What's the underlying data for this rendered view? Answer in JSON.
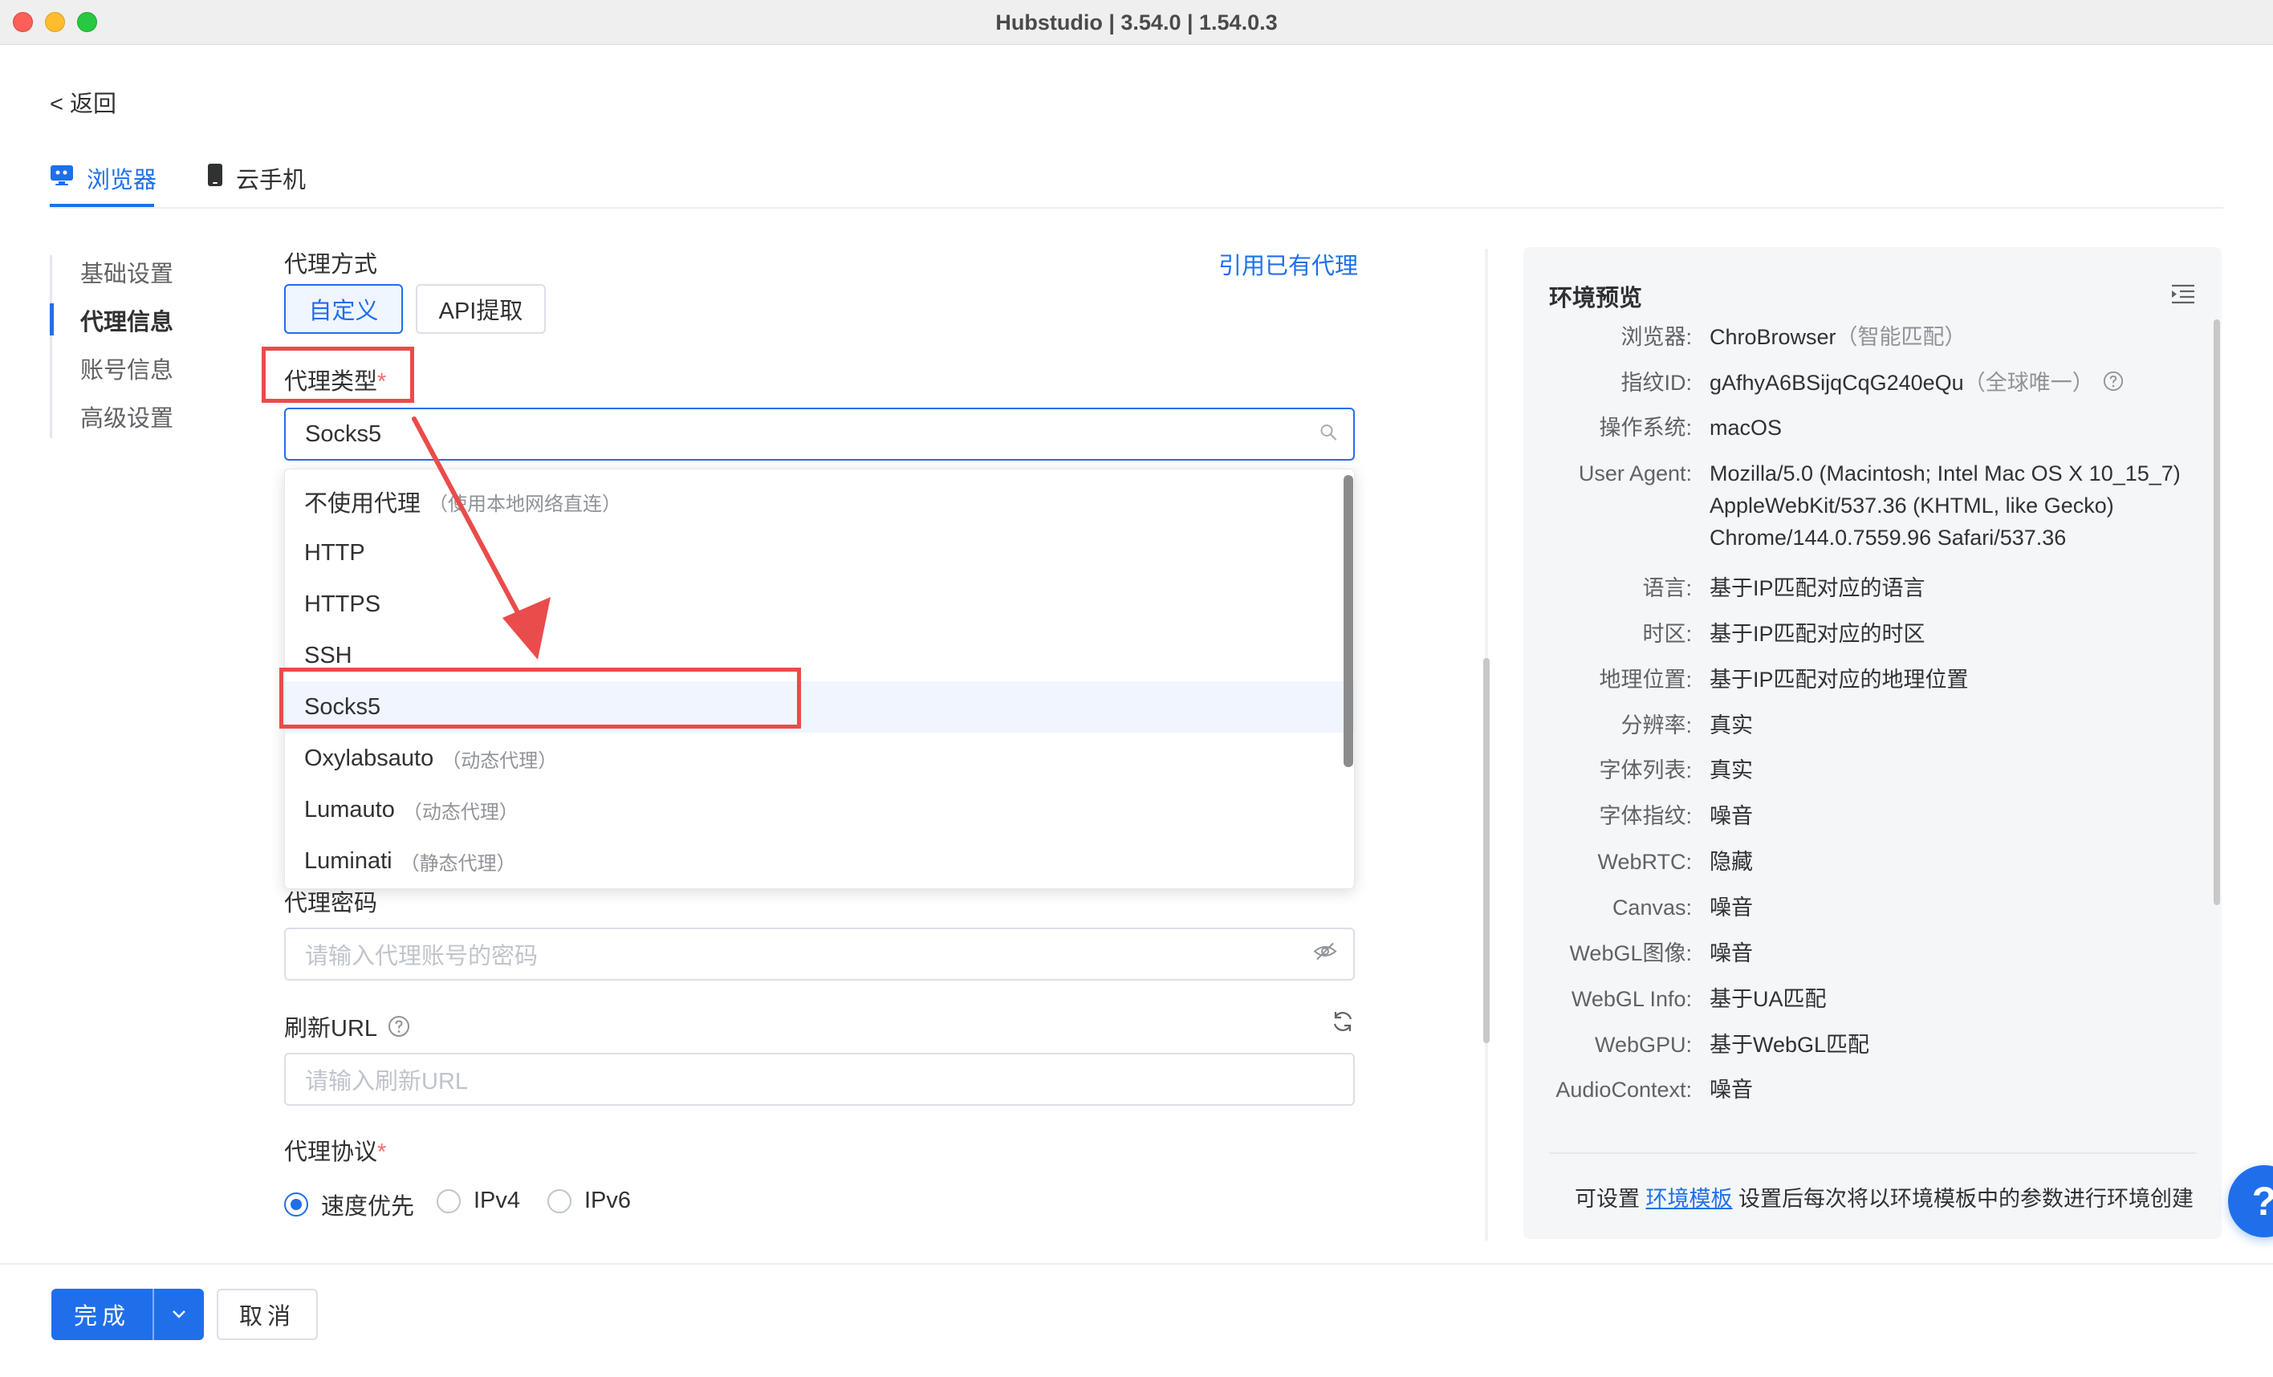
{
  "window": {
    "title": "Hubstudio | 3.54.0 | 1.54.0.3"
  },
  "back": {
    "label": "< 返回"
  },
  "tabs": [
    {
      "label": "浏览器",
      "icon": "browser-monitor-icon",
      "active": true
    },
    {
      "label": "云手机",
      "icon": "phone-icon",
      "active": false
    }
  ],
  "sidebar": {
    "items": [
      {
        "label": "基础设置",
        "active": false
      },
      {
        "label": "代理信息",
        "active": true
      },
      {
        "label": "账号信息",
        "active": false
      },
      {
        "label": "高级设置",
        "active": false
      }
    ]
  },
  "form": {
    "proxy_mode_label": "代理方式",
    "use_existing_link": "引用已有代理",
    "mode_buttons": {
      "custom": "自定义",
      "api": "API提取"
    },
    "proxy_type_label": "代理类型",
    "required_mark": "*",
    "proxy_type_value": "Socks5",
    "proxy_type_options": [
      {
        "label": "不使用代理",
        "note": "（使用本地网络直连）"
      },
      {
        "label": "HTTP",
        "note": ""
      },
      {
        "label": "HTTPS",
        "note": ""
      },
      {
        "label": "SSH",
        "note": ""
      },
      {
        "label": "Socks5",
        "note": "",
        "selected": true
      },
      {
        "label": "Oxylabsauto",
        "note": "（动态代理）"
      },
      {
        "label": "Lumauto",
        "note": "（动态代理）"
      },
      {
        "label": "Luminati",
        "note": "（静态代理）"
      }
    ],
    "proxy_password_label": "代理密码",
    "proxy_password_placeholder": "请输入代理账号的密码",
    "refresh_url_label": "刷新URL",
    "refresh_url_placeholder": "请输入刷新URL",
    "protocol_label": "代理协议",
    "protocol_options": [
      {
        "label": "速度优先",
        "checked": true
      },
      {
        "label": "IPv4",
        "checked": false
      },
      {
        "label": "IPv6",
        "checked": false
      }
    ]
  },
  "preview": {
    "title": "环境预览",
    "rows": [
      {
        "key": "浏览器:",
        "value": "ChroBrowser",
        "note": "（智能匹配）"
      },
      {
        "key": "指纹ID:",
        "value": "gAfhyA6BSijqCqG240eQu",
        "note": "（全球唯一）"
      },
      {
        "key": "操作系统:",
        "value": "macOS",
        "note": ""
      },
      {
        "key": "User Agent:",
        "value": "Mozilla/5.0 (Macintosh; Intel Mac OS X 10_15_7) AppleWebKit/537.36 (KHTML, like Gecko) Chrome/144.0.7559.96 Safari/537.36",
        "note": ""
      },
      {
        "key": "语言:",
        "value": "基于IP匹配对应的语言",
        "note": ""
      },
      {
        "key": "时区:",
        "value": "基于IP匹配对应的时区",
        "note": ""
      },
      {
        "key": "地理位置:",
        "value": "基于IP匹配对应的地理位置",
        "note": ""
      },
      {
        "key": "分辨率:",
        "value": "真实",
        "note": ""
      },
      {
        "key": "字体列表:",
        "value": "真实",
        "note": ""
      },
      {
        "key": "字体指纹:",
        "value": "噪音",
        "note": ""
      },
      {
        "key": "WebRTC:",
        "value": "隐藏",
        "note": ""
      },
      {
        "key": "Canvas:",
        "value": "噪音",
        "note": ""
      },
      {
        "key": "WebGL图像:",
        "value": "噪音",
        "note": ""
      },
      {
        "key": "WebGL Info:",
        "value": "基于UA匹配",
        "note": ""
      },
      {
        "key": "WebGPU:",
        "value": "基于WebGL匹配",
        "note": ""
      },
      {
        "key": "AudioContext:",
        "value": "噪音",
        "note": ""
      }
    ],
    "footer_prefix": "可设置",
    "footer_link": "环境模板",
    "footer_suffix": "设置后每次将以环境模板中的参数进行环境创建"
  },
  "help_button": {
    "label": "?"
  },
  "footer": {
    "done": "完成",
    "cancel": "取消"
  },
  "colors": {
    "accent": "#1f6feb",
    "annotation": "#ea4b4b",
    "required": "#f56c6c"
  }
}
